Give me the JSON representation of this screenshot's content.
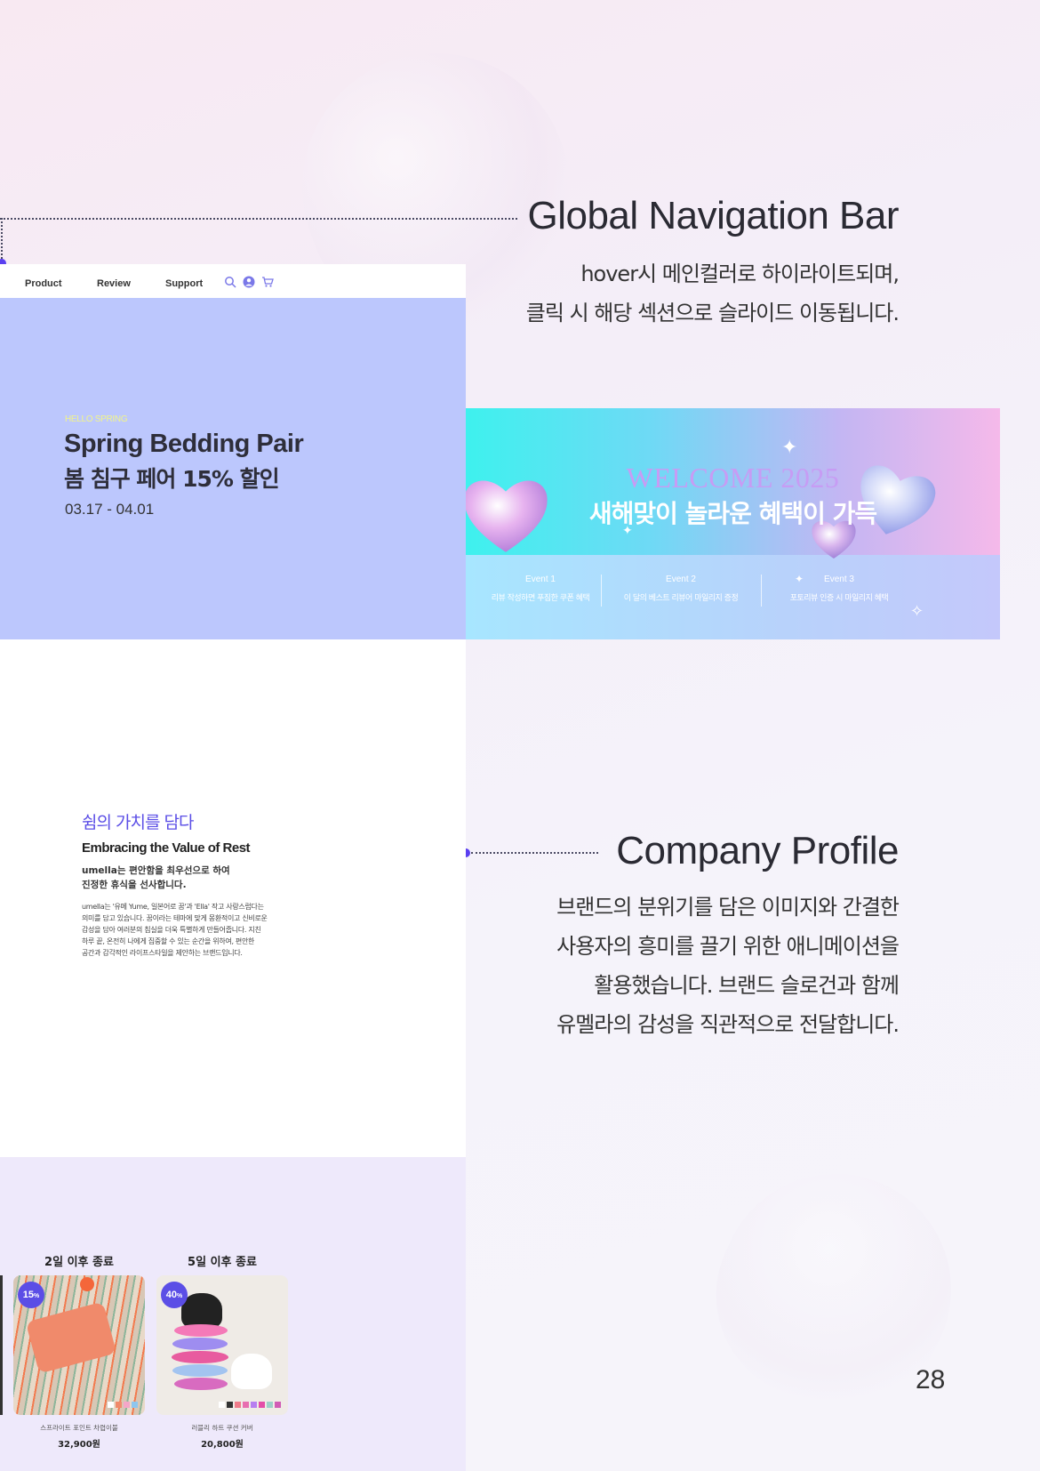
{
  "gnb_annotation": {
    "title": "Global Navigation Bar",
    "line1": "hover시 메인컬러로 하이라이트되며,",
    "line2": "클릭 시 해당 섹션으로 슬라이드 이동됩니다."
  },
  "profile_annotation": {
    "title": "Company Profile",
    "line1": "브랜드의 분위기를 담은 이미지와 간결한",
    "line2": "사용자의 흥미를 끌기 위한 애니메이션을",
    "line3": "활용했습니다. 브랜드 슬로건과 함께",
    "line4": "유멜라의 감성을 직관적으로 전달합니다."
  },
  "nav": {
    "items": [
      "Product",
      "Review",
      "Support"
    ],
    "icons": [
      "search-icon",
      "user-icon",
      "cart-icon"
    ]
  },
  "hero": {
    "kicker": "HELLO SPRING",
    "title_en": "Spring Bedding Pair",
    "title_kr": "봄 침구 페어 15% 할인",
    "date": "03.17 - 04.01"
  },
  "banner": {
    "welcome": "WELCOME 2025",
    "headline": "새해맞이 놀라운 혜택이 가득",
    "events": [
      {
        "label": "Event 1",
        "desc": "리뷰 작성하면 푸짐한 쿠폰 혜택"
      },
      {
        "label": "Event 2",
        "desc": "이 달의 베스트 리뷰어 마일리지 증정"
      },
      {
        "label": "Event 3",
        "desc": "포토리뷰 인증 시 마일리지 혜택"
      }
    ]
  },
  "profile": {
    "title_kr": "쉼의 가치를 담다",
    "title_en": "Embracing the Value of Rest",
    "lead1": "umella는 편안함을 최우선으로 하여",
    "lead2": "진정한 휴식을 선사합니다.",
    "desc1": "umella는 '유메 Yume, 일본어로 꿈'과 'Ella' 작고 사랑스럽다는",
    "desc2": "의미를 담고 있습니다. 꿈이라는 테마에 맞게 몽환적이고 신비로운",
    "desc3": "감성을 담아 여러분의 침실을 더욱 특별하게 만들어줍니다. 지친",
    "desc4": "하루 끝, 온전히 나에게 집중할 수 있는 순간을 위하여, 편안한",
    "desc5": "공간과 감각적인 라이프스타일을 제안하는 브랜드입니다."
  },
  "deals": [
    {
      "ends": "2일 이후 종료",
      "badge": "15",
      "badge_unit": "%",
      "name": "스프라이트 포인트 차렵이불",
      "price": "32,900원",
      "swatches": [
        "#ffffff",
        "#f08a6b",
        "#f5a6c8",
        "#8ec6ee"
      ]
    },
    {
      "ends": "5일 이후 종료",
      "badge": "40",
      "badge_unit": "%",
      "name": "러블리 하트 쿠션 커버",
      "price": "20,800원",
      "swatches": [
        "#ffffff",
        "#333333",
        "#f07b8a",
        "#e86fb0",
        "#b77ef0",
        "#e34fa8",
        "#9dd0c8",
        "#d15cb5"
      ]
    }
  ],
  "page_number": "28",
  "colors": {
    "accent": "#5b4ee6",
    "hero_bg": "#bcc7fd",
    "deals_bg": "#eee9fb"
  }
}
